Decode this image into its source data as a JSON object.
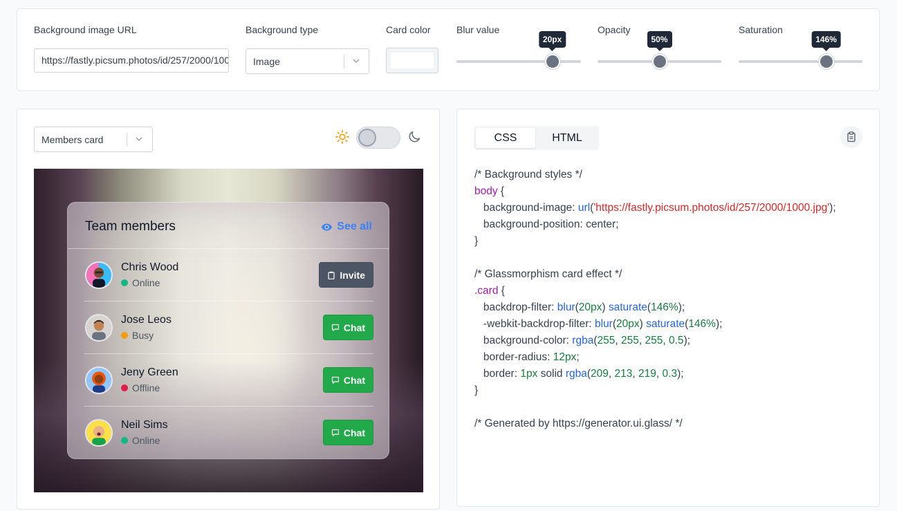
{
  "controls": {
    "bg_url": {
      "label": "Background image URL",
      "value": "https://fastly.picsum.photos/id/257/2000/1000.jpg"
    },
    "bg_type": {
      "label": "Background type",
      "value": "Image"
    },
    "card_color": {
      "label": "Card color",
      "value": "#ffffff"
    },
    "blur": {
      "label": "Blur value",
      "tooltip": "20px",
      "fraction": 0.77
    },
    "opacity": {
      "label": "Opacity",
      "tooltip": "50%",
      "fraction": 0.5
    },
    "saturation": {
      "label": "Saturation",
      "tooltip": "146%",
      "fraction": 0.707
    }
  },
  "preview": {
    "template_select": "Members card",
    "theme_toggle": {
      "dark": false
    },
    "card": {
      "title": "Team members",
      "see_all": "See all",
      "members": [
        {
          "name": "Chris Wood",
          "status": "Online",
          "status_color": "#10b981",
          "action": "Invite"
        },
        {
          "name": "Jose Leos",
          "status": "Busy",
          "status_color": "#f59e0b",
          "action": "Chat"
        },
        {
          "name": "Jeny Green",
          "status": "Offline",
          "status_color": "#e11d48",
          "action": "Chat"
        },
        {
          "name": "Neil Sims",
          "status": "Online",
          "status_color": "#10b981",
          "action": "Chat"
        }
      ]
    }
  },
  "code": {
    "tabs": [
      "CSS",
      "HTML"
    ],
    "active_tab": "CSS",
    "lines": [
      [
        {
          "t": "/* Background styles */",
          "c": "comment"
        }
      ],
      [
        {
          "t": "body",
          "c": "sel"
        },
        {
          "t": " {",
          "c": ""
        }
      ],
      [
        {
          "t": "   background-image: ",
          "c": ""
        },
        {
          "t": "url",
          "c": "fn"
        },
        {
          "t": "(",
          "c": ""
        },
        {
          "t": "'https://fastly.picsum.photos/id/257/2000/1000.jpg'",
          "c": "str"
        },
        {
          "t": ");",
          "c": ""
        }
      ],
      [
        {
          "t": "   background-position: center;",
          "c": ""
        }
      ],
      [
        {
          "t": "}",
          "c": ""
        }
      ],
      [],
      [
        {
          "t": "/* Glassmorphism card effect */",
          "c": "comment"
        }
      ],
      [
        {
          "t": ".card",
          "c": "sel"
        },
        {
          "t": " {",
          "c": ""
        }
      ],
      [
        {
          "t": "   backdrop-filter: ",
          "c": ""
        },
        {
          "t": "blur",
          "c": "fn"
        },
        {
          "t": "(",
          "c": ""
        },
        {
          "t": "20px",
          "c": "num"
        },
        {
          "t": ") ",
          "c": ""
        },
        {
          "t": "saturate",
          "c": "fn"
        },
        {
          "t": "(",
          "c": ""
        },
        {
          "t": "146%",
          "c": "num"
        },
        {
          "t": ");",
          "c": ""
        }
      ],
      [
        {
          "t": "   -webkit-backdrop-filter: ",
          "c": ""
        },
        {
          "t": "blur",
          "c": "fn"
        },
        {
          "t": "(",
          "c": ""
        },
        {
          "t": "20px",
          "c": "num"
        },
        {
          "t": ") ",
          "c": ""
        },
        {
          "t": "saturate",
          "c": "fn"
        },
        {
          "t": "(",
          "c": ""
        },
        {
          "t": "146%",
          "c": "num"
        },
        {
          "t": ");",
          "c": ""
        }
      ],
      [
        {
          "t": "   background-color: ",
          "c": ""
        },
        {
          "t": "rgba",
          "c": "fn"
        },
        {
          "t": "(",
          "c": ""
        },
        {
          "t": "255",
          "c": "num"
        },
        {
          "t": ", ",
          "c": ""
        },
        {
          "t": "255",
          "c": "num"
        },
        {
          "t": ", ",
          "c": ""
        },
        {
          "t": "255",
          "c": "num"
        },
        {
          "t": ", ",
          "c": ""
        },
        {
          "t": "0.5",
          "c": "num"
        },
        {
          "t": ");",
          "c": ""
        }
      ],
      [
        {
          "t": "   border-radius: ",
          "c": ""
        },
        {
          "t": "12px",
          "c": "num"
        },
        {
          "t": ";",
          "c": ""
        }
      ],
      [
        {
          "t": "   border: ",
          "c": ""
        },
        {
          "t": "1px",
          "c": "num"
        },
        {
          "t": " solid ",
          "c": ""
        },
        {
          "t": "rgba",
          "c": "fn"
        },
        {
          "t": "(",
          "c": ""
        },
        {
          "t": "209",
          "c": "num"
        },
        {
          "t": ", ",
          "c": ""
        },
        {
          "t": "213",
          "c": "num"
        },
        {
          "t": ", ",
          "c": ""
        },
        {
          "t": "219",
          "c": "num"
        },
        {
          "t": ", ",
          "c": ""
        },
        {
          "t": "0.3",
          "c": "num"
        },
        {
          "t": ");",
          "c": ""
        }
      ],
      [
        {
          "t": "}",
          "c": ""
        }
      ],
      [],
      [
        {
          "t": "/* Generated by https://generator.ui.glass/ */",
          "c": "comment"
        }
      ]
    ]
  }
}
